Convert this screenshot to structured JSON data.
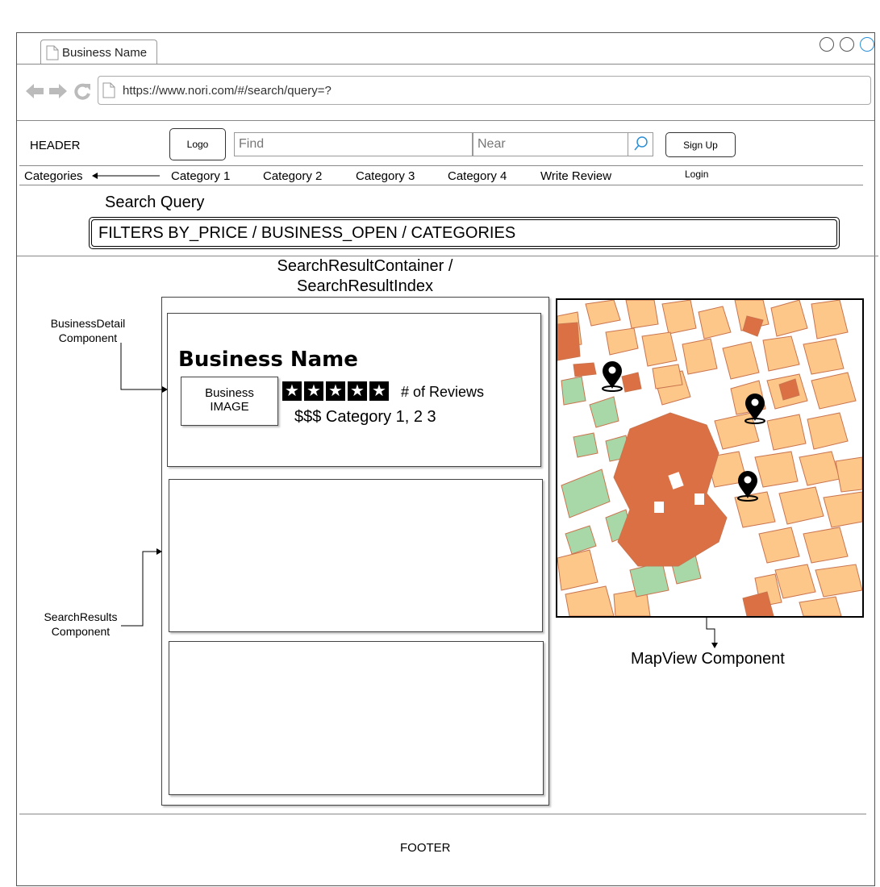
{
  "browser": {
    "tab_title": "Business Name",
    "url": "https://www.nori.com/#/search/query=?"
  },
  "header": {
    "label": "HEADER",
    "logo": "Logo",
    "find_placeholder": "Find",
    "near_placeholder": "Near",
    "signup": "Sign Up",
    "login": "Login"
  },
  "nav": {
    "categories": "Categories",
    "items": [
      "Category 1",
      "Category 2",
      "Category 3",
      "Category 4",
      "Write Review"
    ]
  },
  "search": {
    "title": "Search Query",
    "filters": "FILTERS  BY_PRICE / BUSINESS_OPEN / CATEGORIES"
  },
  "results": {
    "container_title_line1": "SearchResultContainer /",
    "container_title_line2": "SearchResultIndex",
    "business_name": "Business Name",
    "image_line1": "Business",
    "image_line2": "IMAGE",
    "reviews": "# of Reviews",
    "price_categories": "$$$ Category 1, 2 3",
    "star_count": 5
  },
  "annotations": {
    "business_detail_line1": "BusinessDetail",
    "business_detail_line2": "Component",
    "search_results_line1": "SearchResults",
    "search_results_line2": "Component",
    "mapview": "MapView Component"
  },
  "footer": {
    "label": "FOOTER"
  },
  "colors": {
    "map_block": "#fdc78a",
    "map_dark": "#dc7045",
    "map_green": "#a9d8a8",
    "map_border": "#c9744e",
    "search_icon": "#2a8fd6"
  }
}
